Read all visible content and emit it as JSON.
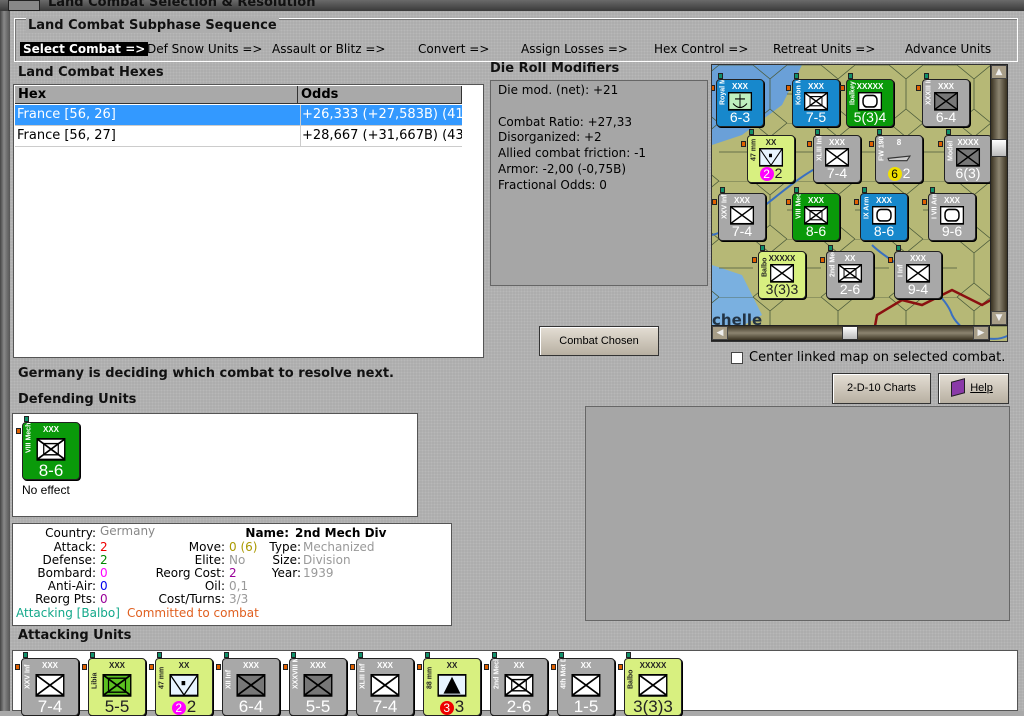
{
  "window": {
    "title": "Land Combat Selection & Resolution"
  },
  "sequence": {
    "title": "Land Combat Subphase Sequence",
    "steps": [
      "Select Combat =>",
      "Def Snow Units =>",
      "Assault or Blitz =>",
      "Convert =>",
      "Assign Losses =>",
      "Hex Control =>",
      "Retreat Units =>",
      "Advance Units"
    ],
    "active": 0
  },
  "hexes": {
    "title": "Land Combat Hexes",
    "columns": [
      "Hex",
      "Odds"
    ],
    "rows": [
      {
        "hex": "France [56, 26]",
        "odds": "+26,333 (+27,583B) (41",
        "selected": true
      },
      {
        "hex": "France [56, 27]",
        "odds": "+28,667 (+31,667B) (43",
        "selected": false
      }
    ]
  },
  "drm": {
    "title": "Die Roll Modifiers",
    "lines": [
      "Die mod. (net): +21",
      "",
      "Combat Ratio: +27,33",
      "Disorganized: +2",
      "Allied combat friction: -1",
      "Armor: -2,00 (-0,75B)",
      "Fractional Odds: 0"
    ]
  },
  "combat_chosen_label": "Combat Chosen",
  "center_map": {
    "label": "Center linked map on selected combat.",
    "checked": false
  },
  "charts_label": "2-D-10 Charts",
  "help_label": "Help",
  "status_text": "Germany is deciding which combat to resolve next.",
  "defending": {
    "title": "Defending Units",
    "units": [
      {
        "name": "VIII Mech",
        "size": "XXX",
        "value": "8-6",
        "color": "green",
        "symbol": "mech",
        "result": "No effect"
      }
    ]
  },
  "info": {
    "country_label": "Country:",
    "country": "Germany",
    "attack_label": "Attack:",
    "attack": "2",
    "defense_label": "Defense:",
    "defense": "2",
    "bombard_label": "Bombard:",
    "bombard": "0",
    "antiair_label": "Anti-Air:",
    "antiair": "0",
    "reorgpts_label": "Reorg Pts:",
    "reorgpts": "0",
    "move_label": "Move:",
    "move": "0 (6)",
    "elite_label": "Elite:",
    "elite": "No",
    "reorgcost_label": "Reorg Cost:",
    "reorgcost": "2",
    "oil_label": "Oil:",
    "oil": "0,1",
    "costturns_label": "Cost/Turns:",
    "costturns": "3/3",
    "name_label": "Name:",
    "name": "2nd Mech Div",
    "type_label": "Type:",
    "type": "Mechanized",
    "size_label": "Size:",
    "size": "Division",
    "year_label": "Year:",
    "year": "1939",
    "attacking": "Attacking [Balbo]",
    "committed": "Committed to combat"
  },
  "attacking": {
    "title": "Attacking Units",
    "units": [
      {
        "name": "XXV Inf",
        "size": "XXX",
        "value": "7-4",
        "color": "gray",
        "symbol": "inf"
      },
      {
        "name": "Libia",
        "size": "XXX",
        "value": "5-5",
        "color": "yellow",
        "symbol": "mech-green"
      },
      {
        "name": "47 mm",
        "size": "XX",
        "value": "2",
        "badge": "2",
        "badge_color": "#ff00ff",
        "color": "yellow",
        "symbol": "atk"
      },
      {
        "name": "XII Inf",
        "size": "XXX",
        "value": "6-4",
        "color": "gray",
        "symbol": "inf-dark"
      },
      {
        "name": "XXXVIII Mot",
        "size": "XXX",
        "value": "5-5",
        "color": "gray",
        "symbol": "inf-dark"
      },
      {
        "name": "XLIII Inf",
        "size": "XXX",
        "value": "7-4",
        "color": "gray",
        "symbol": "inf"
      },
      {
        "name": "88 mm",
        "size": "XX",
        "value": "3",
        "badge": "3",
        "badge_color": "#ee0000",
        "color": "yellow",
        "symbol": "aa"
      },
      {
        "name": "2nd Mech Div",
        "size": "XX",
        "value": "2-6",
        "color": "gray",
        "symbol": "mech"
      },
      {
        "name": "4th Mot Div",
        "size": "XX",
        "value": "1-5",
        "color": "gray",
        "symbol": "inf"
      },
      {
        "name": "Balbo",
        "size": "XXXXX",
        "value": "3(3)3",
        "color": "yellow",
        "symbol": "inf"
      }
    ]
  },
  "map": {
    "place_label": "chelle",
    "counters": [
      {
        "name": "Royal Mar",
        "size": "XXX",
        "value": "6-3",
        "color": "blue",
        "symbol": "marine"
      },
      {
        "name": "Kolon Mech",
        "size": "XXX",
        "value": "7-5",
        "color": "blue",
        "symbol": "mech"
      },
      {
        "name": "Ibalkey",
        "size": "XXXXX",
        "value": "5(3)4",
        "color": "green",
        "symbol": "armor"
      },
      {
        "name": "XXXIII Inf",
        "size": "XXX",
        "value": "6-4",
        "color": "gray",
        "symbol": "inf-dark"
      },
      {
        "name": "47 mm",
        "size": "XX",
        "value": "2",
        "badge": "2",
        "badge_color": "#ff00ff",
        "color": "yellow",
        "symbol": "atk"
      },
      {
        "name": "XLIII Inf",
        "size": "XXX",
        "value": "7-4",
        "color": "gray",
        "symbol": "inf"
      },
      {
        "name": "FW 190 A-8",
        "size": "8",
        "value": "2",
        "badge": "6",
        "badge_color": "#f0e000",
        "color": "gray",
        "symbol": "air"
      },
      {
        "name": "Model",
        "size": "XXXX",
        "value": "6(3)",
        "color": "gray",
        "symbol": "inf-dark"
      },
      {
        "name": "XXV Inf",
        "size": "XXX",
        "value": "7-4",
        "color": "gray",
        "symbol": "inf"
      },
      {
        "name": "VIII Mech",
        "size": "XXX",
        "value": "8-6",
        "color": "green",
        "symbol": "mech"
      },
      {
        "name": "IX Arm",
        "size": "XXX",
        "value": "8-6",
        "color": "blue",
        "symbol": "armor"
      },
      {
        "name": "I VII Arm",
        "size": "XXX",
        "value": "9-6",
        "color": "gray",
        "symbol": "armor"
      },
      {
        "name": "Balbo",
        "size": "XXXXX",
        "value": "3(3)3",
        "color": "yellow",
        "symbol": "inf"
      },
      {
        "name": "2nd Mech Div",
        "size": "XX",
        "value": "2-6",
        "color": "gray",
        "symbol": "mech"
      },
      {
        "name": "I Inf",
        "size": "XXX",
        "value": "9-4",
        "color": "gray",
        "symbol": "inf"
      }
    ]
  },
  "colors": {
    "selection": "#3399ff",
    "counter_gray": "#a8a8a8",
    "counter_green": "#0a9a0a",
    "counter_blue": "#1788cc",
    "counter_yellow": "#d8f080",
    "attacking_text": "#13a88a",
    "committed_text": "#e06020"
  }
}
